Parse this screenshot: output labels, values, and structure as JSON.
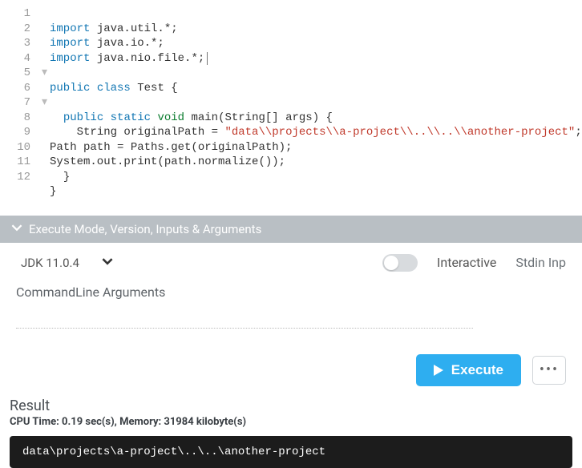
{
  "editor": {
    "lines": {
      "l1a": "import",
      "l1b": " java.util.*;",
      "l2a": "import",
      "l2b": " java.io.*;",
      "l3a": "import",
      "l3b": " java.nio.file.*;",
      "l4": "",
      "l5a": "public",
      "l5b": " class",
      "l5c": " Test {",
      "l6": "",
      "l7a": "public",
      "l7b": " static",
      "l7c": " void",
      "l7d": " main(String[] args) {",
      "l8a": "String originalPath = ",
      "l8b": "\"data\\\\projects\\\\a-project\\\\..\\\\..\\\\another-project\"",
      "l8c": ";",
      "l9": "Path path = Paths.get(originalPath);",
      "l10": "System.out.print(path.normalize());",
      "l11": "}",
      "l12": "}"
    },
    "line_numbers": [
      "1",
      "2",
      "3",
      "4",
      "5",
      "6",
      "7",
      "8",
      "9",
      "10",
      "11",
      "12"
    ],
    "fold_marker": "▾"
  },
  "panel": {
    "title": "Execute Mode, Version, Inputs & Arguments",
    "jdk_label": "JDK 11.0.4",
    "interactive_label": "Interactive",
    "stdin_label": "Stdin Inp",
    "cmd_label": "CommandLine Arguments",
    "cmd_value": ""
  },
  "actions": {
    "execute_label": "Execute",
    "more_label": "•••"
  },
  "result": {
    "heading": "Result",
    "meta": "CPU Time: 0.19 sec(s), Memory: 31984 kilobyte(s)",
    "output": "data\\projects\\a-project\\..\\..\\another-project"
  }
}
